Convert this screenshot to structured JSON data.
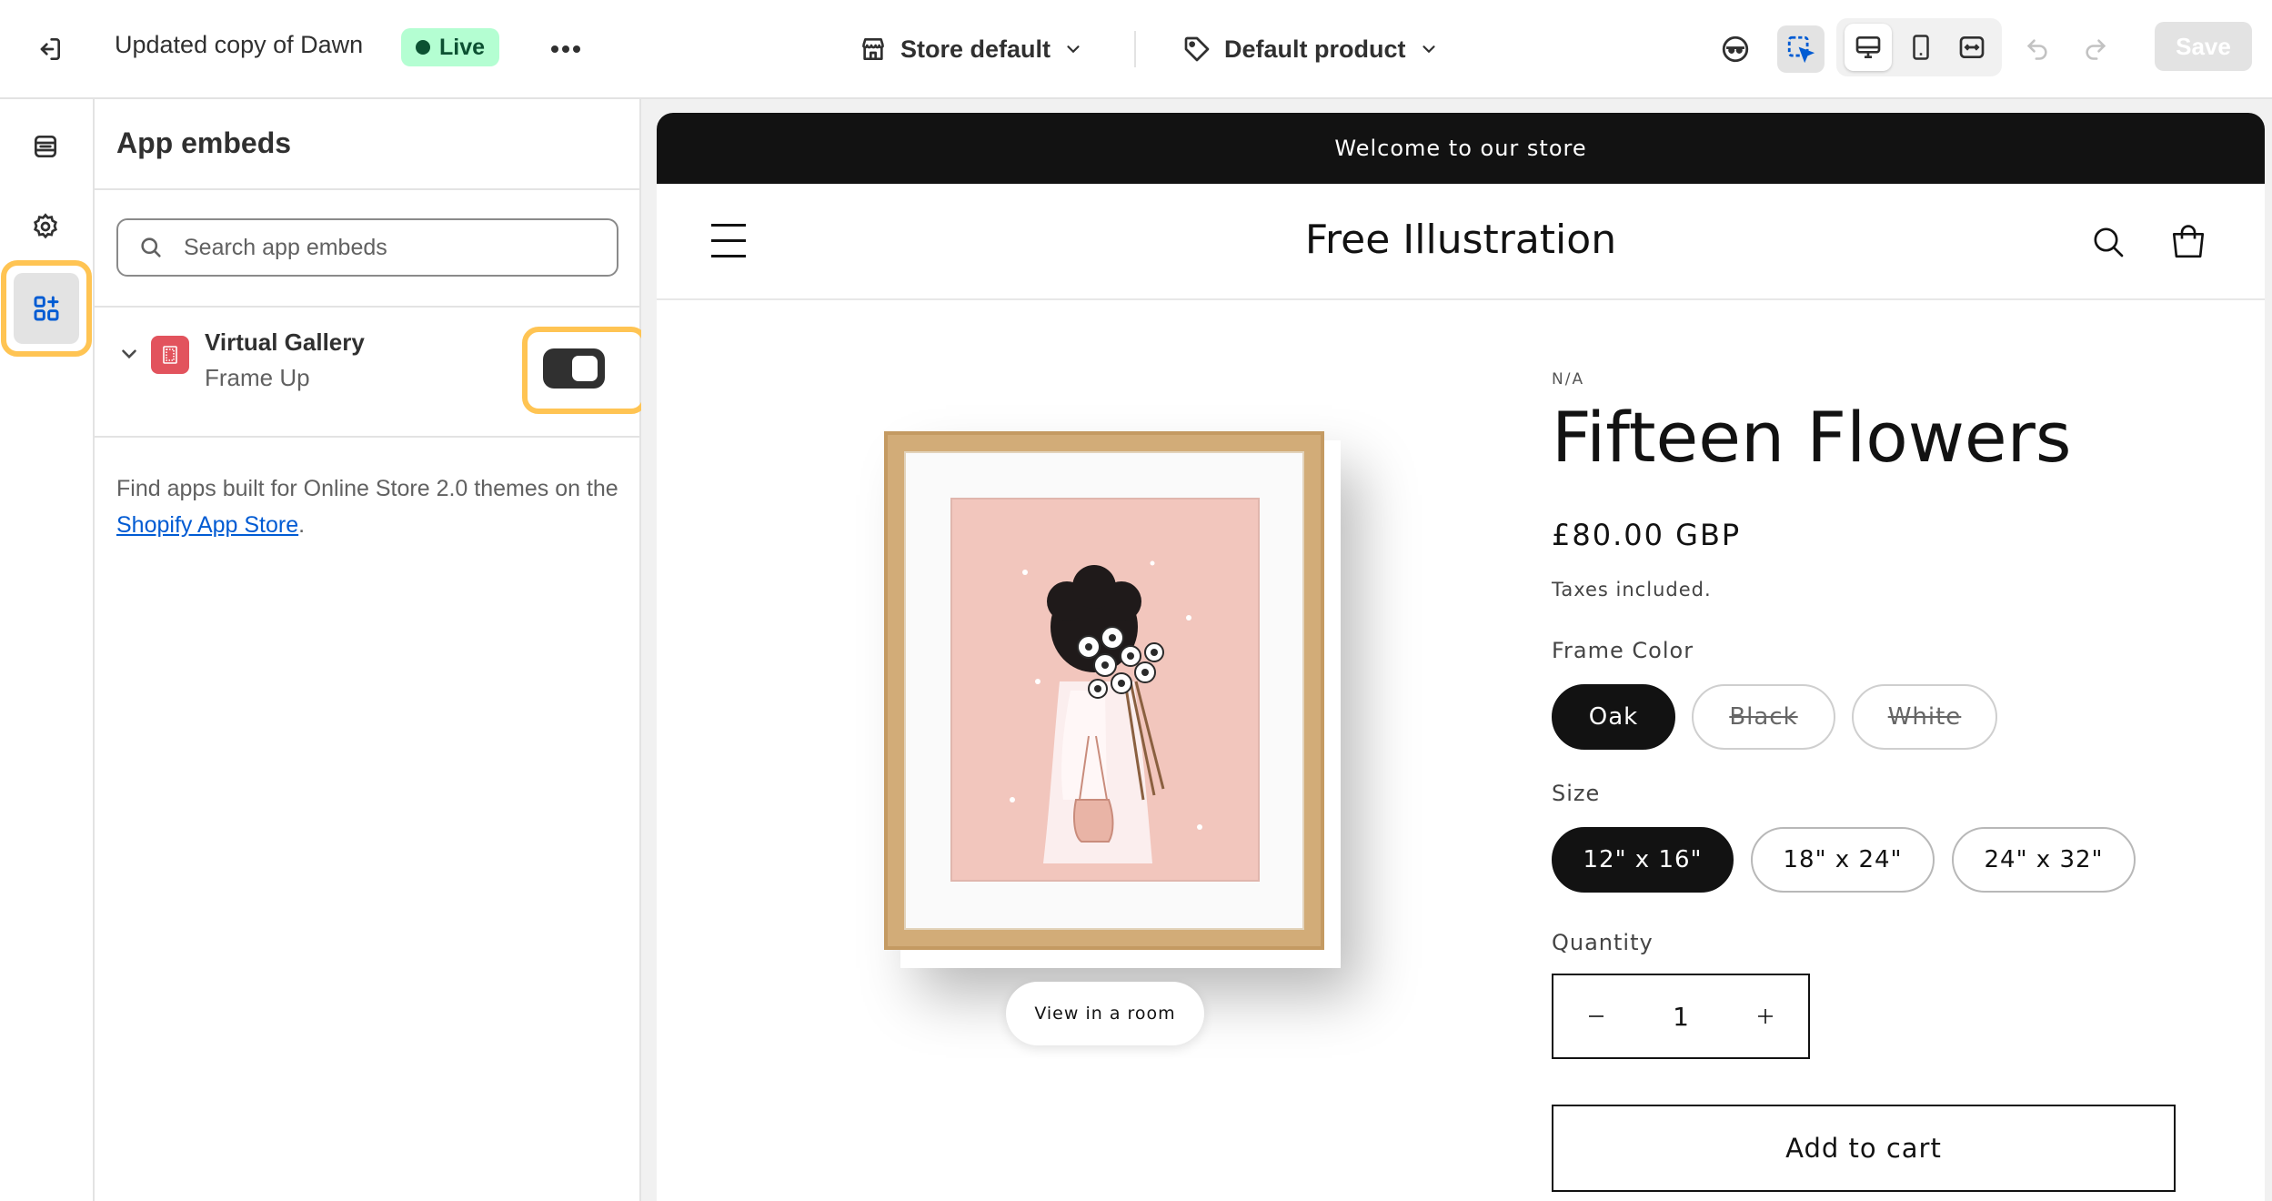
{
  "topbar": {
    "exit_icon": "exit-icon",
    "theme_name": "Updated copy of Dawn",
    "status_badge": "Live",
    "more_icon": "ellipsis-icon",
    "store_selector": "Store default",
    "template_selector": "Default product",
    "save_label": "Save",
    "accent_live": "#b4fed2"
  },
  "rail": {
    "items": [
      {
        "icon": "sections-icon",
        "active": false
      },
      {
        "icon": "gear-icon",
        "active": false
      },
      {
        "icon": "app-embeds-icon",
        "active": true
      }
    ]
  },
  "panel": {
    "title": "App embeds",
    "search_placeholder": "Search app embeds",
    "embed": {
      "name": "Virtual Gallery",
      "provider": "Frame Up",
      "enabled": true
    },
    "help_prefix": "Find apps built for Online Store 2.0 themes on the ",
    "help_link": "Shopify App Store",
    "help_suffix": "."
  },
  "store": {
    "announcement": "Welcome to our store",
    "name": "Free Illustration",
    "view_in_room": "View in a room",
    "product": {
      "vendor": "N/A",
      "title": "Fifteen Flowers",
      "price": "£80.00 GBP",
      "tax_note": "Taxes included.",
      "frame_color_label": "Frame Color",
      "frame_colors": [
        "Oak",
        "Black",
        "White"
      ],
      "size_label": "Size",
      "sizes": [
        "12\" x 16\"",
        "18\" x 24\"",
        "24\" x 32\""
      ],
      "quantity_label": "Quantity",
      "quantity": "1",
      "add_to_cart": "Add to cart"
    }
  },
  "highlight_color": "#ffc453"
}
